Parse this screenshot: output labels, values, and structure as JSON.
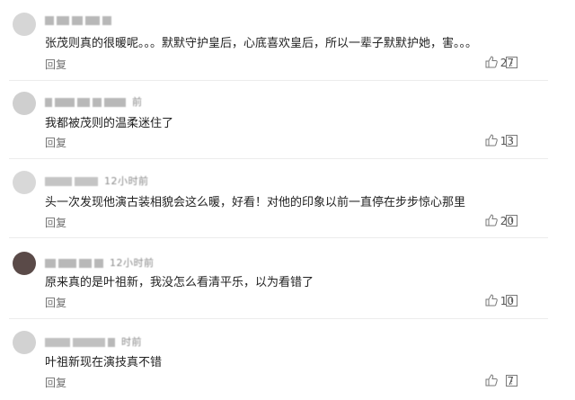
{
  "icons": {
    "like": "thumbs-up-icon",
    "report": "report-icon"
  },
  "comments": [
    {
      "meta": "",
      "text": "张茂则真的很暖呢。。。默默守护皇后，心底喜欢皇后，所以一辈子默默护她，害。。。",
      "reply_label": "回复",
      "likes": "27"
    },
    {
      "meta": "前",
      "text": "我都被茂则的温柔迷住了",
      "reply_label": "回复",
      "likes": "13"
    },
    {
      "meta": "12小时前",
      "text": "头一次发现他演古装相貌会这么暖，好看！对他的印象以前一直停在步步惊心那里",
      "reply_label": "回复",
      "likes": "20"
    },
    {
      "meta": "12小时前",
      "text": "原来真的是叶祖新，我没怎么看清平乐，以为看错了",
      "reply_label": "回复",
      "likes": "10"
    },
    {
      "meta": "时前",
      "text": "叶祖新现在演技真不错",
      "reply_label": "回复",
      "likes": "7"
    }
  ]
}
